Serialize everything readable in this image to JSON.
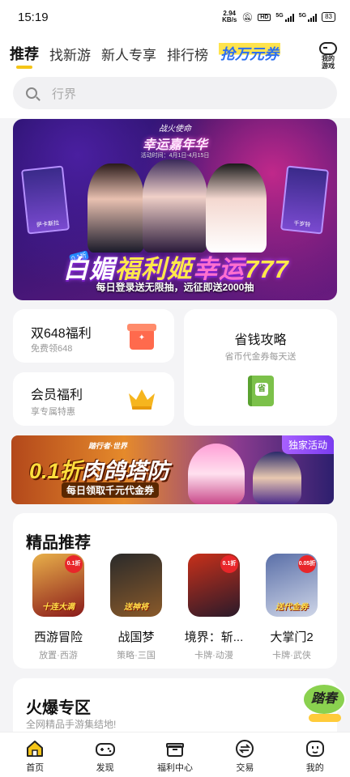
{
  "status": {
    "time": "15:19",
    "net_speed_value": "2.94",
    "net_speed_unit": "KB/s",
    "hd": "HD",
    "net1": "5G",
    "net2": "5G",
    "battery": "83"
  },
  "header": {
    "tabs": [
      "推荐",
      "找新游",
      "新人专享",
      "排行榜"
    ],
    "promo_tab": "抢万元券",
    "my_games": [
      "我的",
      "游戏"
    ]
  },
  "search": {
    "placeholder": "行界"
  },
  "banner": {
    "event_sub": "战火使命",
    "event_title": "幸运嘉年华",
    "event_date": "活动时间：4月1日-4月15日",
    "card_left_name": "萨卡斯拉",
    "card_right_name": "千岁铃",
    "tag": "0.1折",
    "main_title_a": "白媚",
    "main_title_b": "福利姬",
    "main_title_c": "幸运",
    "main_title_d": "777",
    "caption": "每日登录送无限抽，远征即送2000抽"
  },
  "tiles": {
    "double648": {
      "title": "双648福利",
      "sub": "免费领648"
    },
    "member": {
      "title": "会员福利",
      "sub": "享专属特惠"
    },
    "saving": {
      "title": "省钱攻略",
      "sub": "省币代金券每天送",
      "book_glyph": "省"
    }
  },
  "ad": {
    "small": "踏行者·世界",
    "big_a": "0.1折",
    "big_b": "肉鸽塔防",
    "sub": "每日领取千元代金券",
    "badge": "独家活动"
  },
  "featured": {
    "heading": "精品推荐",
    "games": [
      {
        "name": "西游冒险",
        "category": "放置·西游",
        "tag": "0.1折",
        "band": "十连大满",
        "colors": [
          "#e8b04a",
          "#8a1a1a"
        ]
      },
      {
        "name": "战国梦",
        "category": "策略·三国",
        "tag": "",
        "band": "送神将",
        "colors": [
          "#2a2a2a",
          "#8a5a2a"
        ]
      },
      {
        "name": "境界：斩...",
        "category": "卡牌·动漫",
        "tag": "0.1折",
        "band": "",
        "colors": [
          "#c8301a",
          "#2a1a2a"
        ]
      },
      {
        "name": "大掌门2",
        "category": "卡牌·武侠",
        "tag": "0.05折",
        "band": "送代金券",
        "colors": [
          "#5a6fa8",
          "#cfd6e8"
        ]
      }
    ]
  },
  "hot": {
    "heading": "火爆专区",
    "sub": "全网精品手游集结地!",
    "float_label": "踏春"
  },
  "tabbar": [
    "首页",
    "发现",
    "福利中心",
    "交易",
    "我的"
  ],
  "colors": {
    "accent": "#f5c518",
    "promo": "#2d6ff0",
    "badge": "#a860ff"
  }
}
